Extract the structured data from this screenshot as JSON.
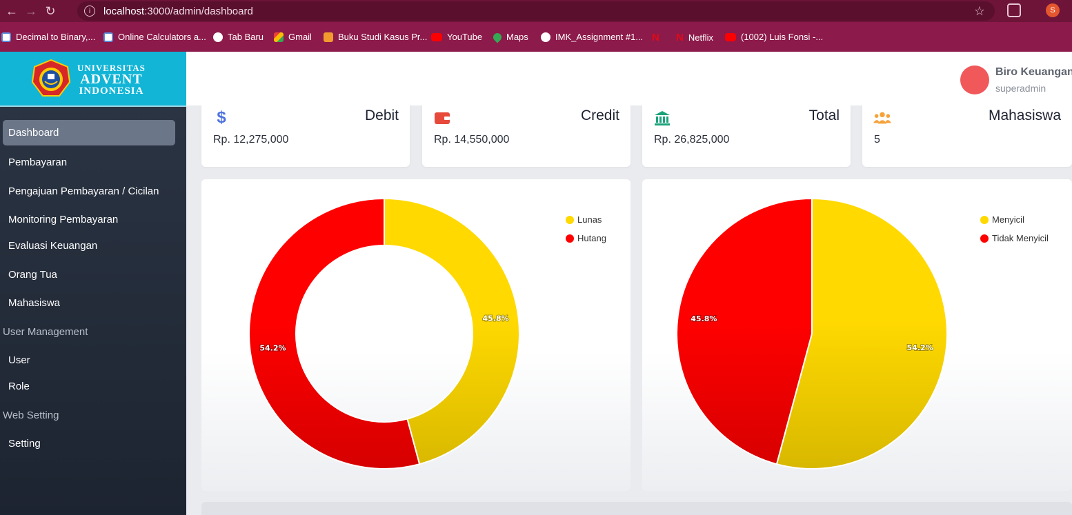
{
  "browser": {
    "url_host": "localhost",
    "url_path": ":3000/admin/dashboard",
    "profile_initial": "S",
    "bookmarks": [
      {
        "label": "Decimal to Binary,...",
        "icon": "doc-icon"
      },
      {
        "label": "Online Calculators a...",
        "icon": "doc-icon"
      },
      {
        "label": "Tab Baru",
        "icon": "globe-icon"
      },
      {
        "label": "Gmail",
        "icon": "gmail-icon"
      },
      {
        "label": "Buku Studi Kasus Pr...",
        "icon": "academic-icon"
      },
      {
        "label": "YouTube",
        "icon": "youtube-icon"
      },
      {
        "label": "Maps",
        "icon": "maps-icon"
      },
      {
        "label": "IMK_Assignment #1...",
        "icon": "globe-icon"
      },
      {
        "label": "",
        "icon": "netflix-icon"
      },
      {
        "label": "Netflix",
        "icon": "netflix-icon"
      },
      {
        "label": "(1002) Luis Fonsi -...",
        "icon": "youtube-icon"
      }
    ]
  },
  "brand": {
    "line1": "UNIVERSITAS",
    "line2": "ADVENT",
    "line3": "INDONESIA"
  },
  "sidebar": {
    "items": [
      {
        "label": "Dashboard",
        "active": true
      },
      {
        "label": "Pembayaran"
      },
      {
        "label": "Pengajuan Pembayaran / Cicilan"
      },
      {
        "label": "Monitoring Pembayaran"
      },
      {
        "label": "Evaluasi Keuangan"
      },
      {
        "label": "Orang Tua"
      },
      {
        "label": "Mahasiswa"
      }
    ],
    "heading_user_management": "User Management",
    "user_items": [
      {
        "label": "User"
      },
      {
        "label": "Role"
      }
    ],
    "heading_web_setting": "Web Setting",
    "setting_items": [
      {
        "label": "Setting"
      }
    ]
  },
  "user": {
    "name": "Biro Keuangan",
    "role": "superadmin"
  },
  "cards": [
    {
      "title": "Debit",
      "value": "Rp. 12,275,000",
      "icon": "dollar-icon",
      "color": "#4e73df"
    },
    {
      "title": "Credit",
      "value": "Rp. 14,550,000",
      "icon": "wallet-icon",
      "color": "#e74a3b"
    },
    {
      "title": "Total",
      "value": "Rp. 26,825,000",
      "icon": "bank-icon",
      "color": "#1cc88a"
    },
    {
      "title": "Mahasiswa",
      "value": "5",
      "icon": "users-icon",
      "color": "#f6a23a"
    }
  ],
  "colors": {
    "yellow": "#ffd900",
    "red": "#ff0000",
    "browser_bar": "#6e1438",
    "bookmark_bar": "#8c1a4a",
    "brand": "#12b5d6"
  },
  "chart_data": [
    {
      "type": "pie",
      "donut": true,
      "categories": [
        "Lunas",
        "Hutang"
      ],
      "values": [
        45.8,
        54.2
      ],
      "labels": [
        "45.8%",
        "54.2%"
      ],
      "legend": "top-right"
    },
    {
      "type": "pie",
      "donut": false,
      "categories": [
        "Menyicil",
        "Tidak Menyicil"
      ],
      "values": [
        54.2,
        45.8
      ],
      "labels": [
        "54.2%",
        "45.8%"
      ],
      "legend": "top-right"
    }
  ]
}
